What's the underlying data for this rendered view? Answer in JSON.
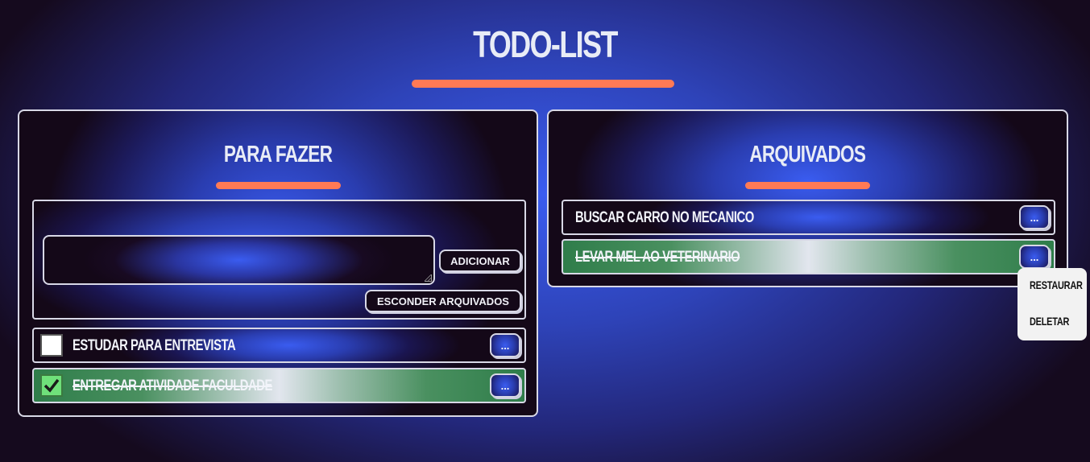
{
  "app": {
    "title": "TODO-LIST"
  },
  "todo_panel": {
    "title": "PARA FAZER",
    "input": {
      "value": "",
      "placeholder": ""
    },
    "add_button": "ADICIONAR",
    "hide_archived_button": "ESCONDER ARQUIVADOS",
    "items": [
      {
        "text": "ESTUDAR PARA ENTREVISTA",
        "done": false,
        "more": "..."
      },
      {
        "text": "ENTREGAR ATIVIDADE FACULDADE",
        "done": true,
        "more": "..."
      }
    ]
  },
  "archived_panel": {
    "title": "ARQUIVADOS",
    "items": [
      {
        "text": "BUSCAR CARRO NO MECANICO",
        "done": false,
        "more": "..."
      },
      {
        "text": "LEVAR MEL AO VETERINARIO",
        "done": true,
        "more": "..."
      }
    ]
  },
  "context_menu": {
    "items": [
      "RESTAURAR",
      "DELETAR"
    ]
  },
  "colors": {
    "accent": "#ff7a55",
    "done_green": "#2f7d4a",
    "primary_blue": "#3a5cf0",
    "dark": "#140818"
  }
}
